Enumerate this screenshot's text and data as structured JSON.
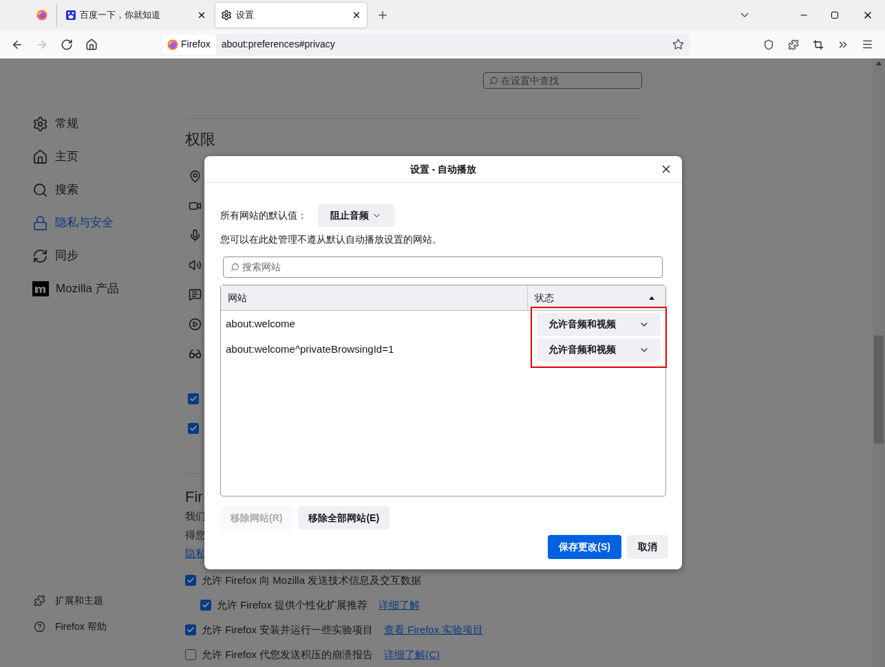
{
  "tabs": [
    {
      "kind": "pinned",
      "selected": false
    },
    {
      "kind": "baidu",
      "title": "百度一下，你就知道",
      "selected": false
    },
    {
      "kind": "settings",
      "title": "设置",
      "selected": true
    }
  ],
  "nav_buttons": [
    {
      "kind": "back",
      "disabled": false
    },
    {
      "kind": "forward",
      "disabled": true
    },
    {
      "kind": "reload",
      "disabled": false
    },
    {
      "kind": "home",
      "disabled": false
    }
  ],
  "url_bar": {
    "identity": "Firefox",
    "address": "about:preferences#privacy"
  },
  "sidebar": {
    "items": [
      {
        "kind": "gear",
        "label": "常规",
        "selected": false
      },
      {
        "kind": "home",
        "label": "主页",
        "selected": false
      },
      {
        "kind": "search",
        "label": "搜索",
        "selected": false
      },
      {
        "kind": "lock",
        "label": "隐私与安全",
        "selected": true
      },
      {
        "kind": "sync",
        "label": "同步",
        "selected": false
      },
      {
        "kind": "mozilla",
        "label": "Mozilla 产品",
        "selected": false
      }
    ],
    "footer_items": [
      {
        "kind": "puzzle",
        "label": "扩展和主题"
      },
      {
        "kind": "help",
        "label": "Firefox 帮助"
      }
    ]
  },
  "page": {
    "search": {
      "placeholder": "在设置中查找"
    },
    "section_title": "权限",
    "permission_checkboxes": [
      {
        "checked": true
      },
      {
        "checked": true
      }
    ],
    "data_section": {
      "heading": "Fir",
      "lines": [
        "我们",
        "得您"
      ],
      "link": "隐私",
      "options": [
        {
          "label": "允许 Firefox 向 Mozilla 发送技术信息及交互数据",
          "checked": true,
          "children": [
            {
              "label": "允许 Firefox 提供个性化扩展推荐",
              "link": "详细了解",
              "checked": true
            }
          ]
        },
        {
          "label": "允许 Firefox 安装并运行一些实验项目",
          "link": "查看 Firefox 实验项目",
          "checked": true
        },
        {
          "label": "允许 Firefox 代您发送积压的崩溃报告",
          "link": "详细了解(C)",
          "checked": false
        }
      ]
    }
  },
  "dialog": {
    "title": "设置 - 自动播放",
    "default_label": "所有网站的默认值：",
    "default_value": "阻止音频",
    "description": "您可以在此处管理不遵从默认自动播放设置的网站。",
    "search": {
      "placeholder": "搜索网站"
    },
    "columns": [
      {
        "label": "网站",
        "sorted": false
      },
      {
        "label": "状态",
        "sorted": true
      }
    ],
    "status_highlighted": true,
    "rows": [
      {
        "site": "about:welcome",
        "status": "允许音频和视频"
      },
      {
        "site": "about:welcome^privateBrowsingId=1",
        "status": "允许音频和视频"
      }
    ],
    "list_buttons": [
      {
        "label": "移除网站(R)",
        "disabled": true
      },
      {
        "label": "移除全部网站(E)",
        "disabled": false
      }
    ],
    "footer_buttons": [
      {
        "kind": "primary",
        "label": "保存更改(S)"
      },
      {
        "kind": "secondary",
        "label": "取消"
      }
    ]
  }
}
